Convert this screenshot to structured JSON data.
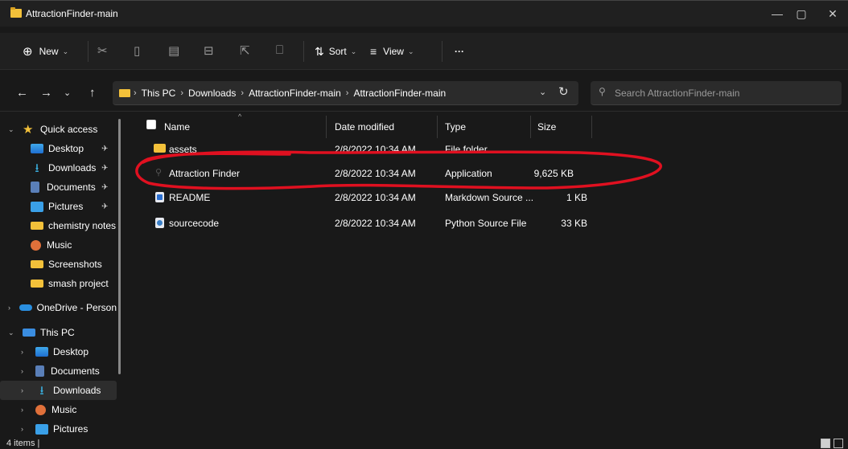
{
  "window": {
    "title": "AttractionFinder-main",
    "controls": {
      "minimize": "—",
      "maximize": "▢",
      "close": "✕"
    }
  },
  "toolbar": {
    "new_label": "New",
    "sort_label": "Sort",
    "view_label": "View",
    "more_label": "···",
    "icons": [
      "cut-icon",
      "copy-icon",
      "paste-icon",
      "rename-icon",
      "share-icon",
      "delete-icon"
    ]
  },
  "nav": {
    "back": "←",
    "forward": "→",
    "recent": "⌄",
    "up": "↑",
    "breadcrumbs": [
      "This PC",
      "Downloads",
      "AttractionFinder-main",
      "AttractionFinder-main"
    ],
    "separator": "›",
    "refresh": "↻",
    "dropdown": "⌄"
  },
  "search": {
    "placeholder": "Search AttractionFinder-main"
  },
  "sidebar": {
    "items": [
      {
        "label": "Quick access",
        "icon": "star-icon",
        "expander": "⌄"
      },
      {
        "label": "Desktop",
        "icon": "desktop-icon",
        "pinned": true
      },
      {
        "label": "Downloads",
        "icon": "download-icon",
        "pinned": true
      },
      {
        "label": "Documents",
        "icon": "documents-icon",
        "pinned": true
      },
      {
        "label": "Pictures",
        "icon": "pictures-icon",
        "pinned": true
      },
      {
        "label": "chemistry notes",
        "icon": "folder-icon"
      },
      {
        "label": "Music",
        "icon": "music-icon"
      },
      {
        "label": "Screenshots",
        "icon": "folder-icon"
      },
      {
        "label": "smash project",
        "icon": "folder-icon"
      },
      {
        "label": "OneDrive - Person",
        "icon": "cloud-icon",
        "expander": "›"
      },
      {
        "label": "This PC",
        "icon": "pc-icon",
        "expander": "⌄"
      },
      {
        "label": "Desktop",
        "icon": "desktop-icon",
        "expander": "›"
      },
      {
        "label": "Documents",
        "icon": "documents-icon",
        "expander": "›"
      },
      {
        "label": "Downloads",
        "icon": "download-icon",
        "expander": "›",
        "selected": true
      },
      {
        "label": "Music",
        "icon": "music-icon",
        "expander": "›"
      },
      {
        "label": "Pictures",
        "icon": "pictures-icon",
        "expander": "›"
      }
    ],
    "pin_glyph": "✈"
  },
  "columns": {
    "name": "Name",
    "date": "Date modified",
    "type": "Type",
    "size": "Size"
  },
  "files": [
    {
      "name": "assets",
      "date": "2/8/2022 10:34 AM",
      "type": "File folder",
      "size": "",
      "icon": "folder-icon"
    },
    {
      "name": "Attraction Finder",
      "date": "2/8/2022 10:34 AM",
      "type": "Application",
      "size": "9,625 KB",
      "icon": "application-icon"
    },
    {
      "name": "README",
      "date": "2/8/2022 10:34 AM",
      "type": "Markdown Source ...",
      "size": "1 KB",
      "icon": "markdown-file-icon"
    },
    {
      "name": "sourcecode",
      "date": "2/8/2022 10:34 AM",
      "type": "Python Source File",
      "size": "33 KB",
      "icon": "python-file-icon"
    }
  ],
  "status": {
    "item_count": "4 items  |"
  },
  "colors": {
    "annotation": "#e01020",
    "folder": "#f3c13a",
    "background": "#191919"
  }
}
